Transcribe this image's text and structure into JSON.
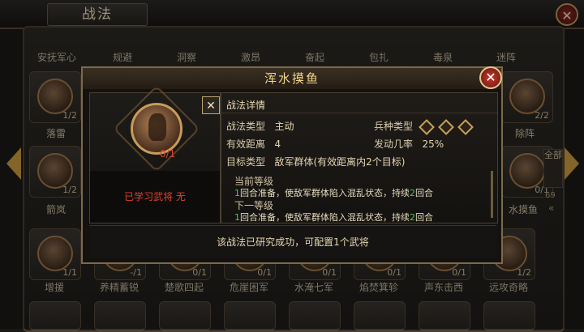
{
  "header": {
    "title": "战法",
    "close_icon": "close-icon"
  },
  "top_row": [
    "安抚军心",
    "规避",
    "洞察",
    "激昂",
    "奋起",
    "包扎",
    "毒泉",
    "迷阵"
  ],
  "left_column": [
    {
      "label": "落雷",
      "count": "1/2"
    },
    {
      "label": "箭岚",
      "count": "1/2"
    }
  ],
  "right_column": [
    {
      "label": "除阵",
      "count": "2/2"
    },
    {
      "label": "水摸鱼",
      "count": "0/1"
    }
  ],
  "all_tab": "全部",
  "side_count": "69",
  "bottom_row": [
    {
      "label": "增援",
      "count": "1/1"
    },
    {
      "label": "养精蓄锐",
      "count": "-/1"
    },
    {
      "label": "楚歌四起",
      "count": "0/1"
    },
    {
      "label": "危崖困军",
      "count": "0/1"
    },
    {
      "label": "水淹七军",
      "count": "0/1"
    },
    {
      "label": "焰焚箕轸",
      "count": "0/1"
    },
    {
      "label": "声东击西",
      "count": "0/1"
    },
    {
      "label": "远攻奇略",
      "count": "1/2"
    }
  ],
  "modal": {
    "title": "浑水摸鱼",
    "skill_count": "0/1",
    "learned_text": "已学习武将 无",
    "x_label": "✕",
    "details_header": "战法详情",
    "type_label": "战法类型",
    "type_value": "主动",
    "range_label": "有效距离",
    "range_value": "4",
    "target_label": "目标类型",
    "target_value": "敌军群体(有效距离内2个目标)",
    "troop_label": "兵种类型",
    "rate_label": "发动几率",
    "rate_value": "25%",
    "current_level_label": "当前等级",
    "current_level": {
      "p1": "1",
      "p2": "回合准备，使敌军群体陷入混乱状态，持续",
      "p3": "2",
      "p4": "回合"
    },
    "next_level_label": "下一等级",
    "next_level": {
      "p1": "1",
      "p2": "回合准备，使敌军群体陷入混乱状态，持续",
      "p3": "2",
      "p4": "回合"
    },
    "footer": "该战法已研究成功，可配置1个武将"
  }
}
